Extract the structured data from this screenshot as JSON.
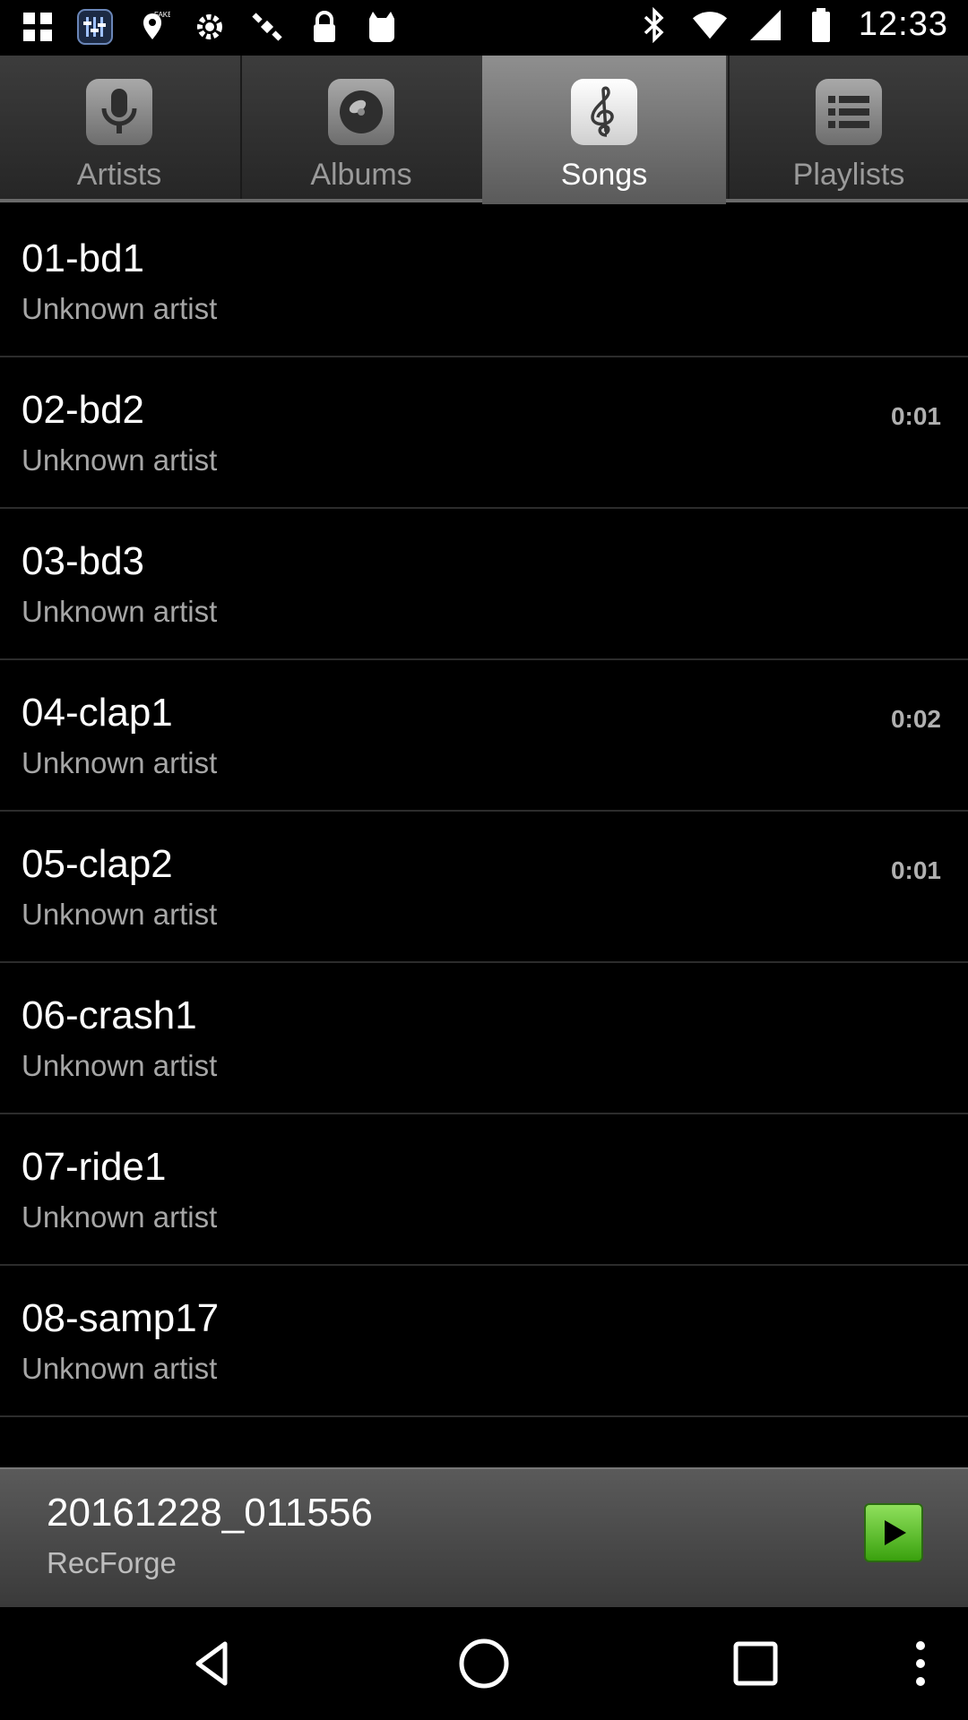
{
  "status_bar": {
    "time": "12:33",
    "left_icons": [
      "grid-app-icon",
      "equalizer-app-icon",
      "fake-gps-icon",
      "settings-gear-icon",
      "satellite-icon",
      "lock-icon",
      "cat-app-icon"
    ],
    "right_icons": [
      "bluetooth-icon",
      "wifi-icon",
      "signal-icon",
      "battery-icon"
    ]
  },
  "tabs": [
    {
      "label": "Artists",
      "icon": "microphone-icon",
      "active": false
    },
    {
      "label": "Albums",
      "icon": "disc-icon",
      "active": false
    },
    {
      "label": "Songs",
      "icon": "treble-clef-icon",
      "active": true
    },
    {
      "label": "Playlists",
      "icon": "list-icon",
      "active": false
    }
  ],
  "songs": [
    {
      "title": "01-bd1",
      "artist": "Unknown artist",
      "duration": ""
    },
    {
      "title": "02-bd2",
      "artist": "Unknown artist",
      "duration": "0:01"
    },
    {
      "title": "03-bd3",
      "artist": "Unknown artist",
      "duration": ""
    },
    {
      "title": "04-clap1",
      "artist": "Unknown artist",
      "duration": "0:02"
    },
    {
      "title": "05-clap2",
      "artist": "Unknown artist",
      "duration": "0:01"
    },
    {
      "title": "06-crash1",
      "artist": "Unknown artist",
      "duration": ""
    },
    {
      "title": "07-ride1",
      "artist": "Unknown artist",
      "duration": ""
    },
    {
      "title": "08-samp17",
      "artist": "Unknown artist",
      "duration": ""
    }
  ],
  "now_playing": {
    "title": "20161228_011556",
    "artist": "RecForge",
    "play_icon": "play-icon",
    "accent": "#5cc02a"
  },
  "nav": {
    "back_icon": "back-icon",
    "home_icon": "home-icon",
    "recents_icon": "recents-icon",
    "menu_icon": "overflow-menu-icon"
  }
}
